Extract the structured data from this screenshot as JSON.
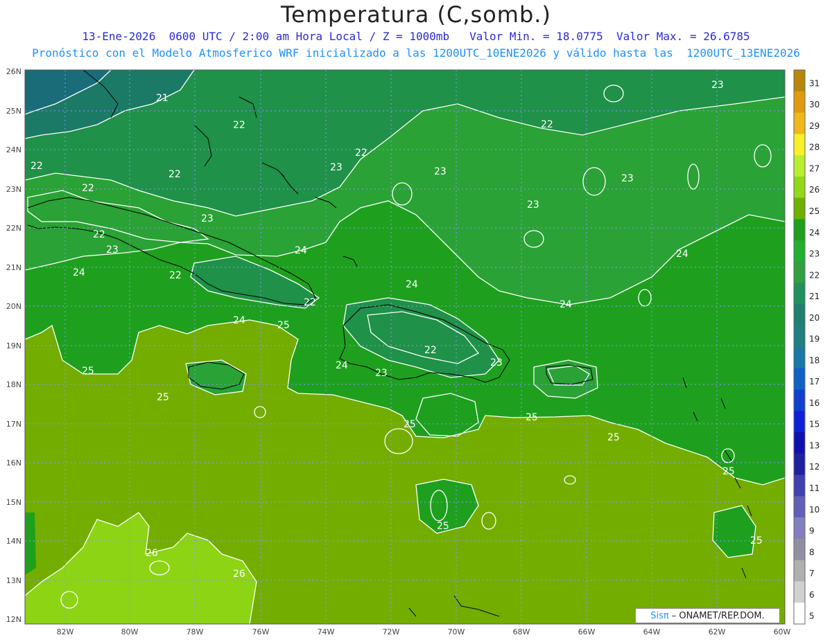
{
  "title": "Temperatura (C,somb.)",
  "subtitle_line1": "13-Ene-2026  0600 UTC / 2:00 am Hora Local / Z = 1000mb   Valor Min. = 18.0775  Valor Max. = 26.6785",
  "subtitle_line2": "Pronóstico con el Modelo Atmosferico WRF inicializado a las 1200UTC_10ENE2026 y válido hasta las  1200UTC_13ENE2026",
  "credit": {
    "logo": "Sisπ",
    "text": "– ONAMET/REP.DOM."
  },
  "axes": {
    "lon_labels": [
      "82W",
      "80W",
      "78W",
      "76W",
      "74W",
      "72W",
      "70W",
      "68W",
      "66W",
      "64W",
      "62W",
      "60W"
    ],
    "lat_labels": [
      "26N",
      "25N",
      "24N",
      "23N",
      "22N",
      "21N",
      "20N",
      "19N",
      "18N",
      "17N",
      "16N",
      "15N",
      "14N",
      "13N",
      "12N"
    ]
  },
  "colorbar": {
    "values": [
      "31",
      "30",
      "29",
      "28",
      "27",
      "26",
      "25",
      "24",
      "23",
      "22",
      "21",
      "20",
      "19",
      "18",
      "17",
      "16",
      "15",
      "13",
      "12",
      "11",
      "10",
      "9",
      "8",
      "7",
      "6",
      "5"
    ],
    "colors": [
      "#b8860b",
      "#e09a10",
      "#f0b818",
      "#f8f028",
      "#b8f030",
      "#90d818",
      "#70b000",
      "#1ea01e",
      "#22b030",
      "#30a040",
      "#209060",
      "#208070",
      "#208080",
      "#1878a8",
      "#1060c8",
      "#1040d0",
      "#1020d8",
      "#1010b0",
      "#2020a0",
      "#4040b0",
      "#6060b8",
      "#8080c0",
      "#9090a0",
      "#b0b0b0",
      "#d0d0d0",
      "#ffffff"
    ]
  },
  "contour_labels": [
    "21",
    "22",
    "22",
    "22",
    "22",
    "22",
    "22",
    "22",
    "23",
    "23",
    "23",
    "23",
    "23",
    "23",
    "24",
    "24",
    "24",
    "24",
    "24",
    "25",
    "25",
    "25",
    "25",
    "25",
    "25",
    "26",
    "26",
    "22",
    "22",
    "23",
    "23",
    "24",
    "25",
    "24",
    "22",
    "23",
    "25",
    "25"
  ],
  "fill_colors": {
    "t25": "#73ad00",
    "t24": "#1ea01e",
    "t23": "#2aa235",
    "t22": "#1f9148",
    "t21": "#1a8060",
    "t20": "#1a7070",
    "t26": "#8cd414"
  }
}
